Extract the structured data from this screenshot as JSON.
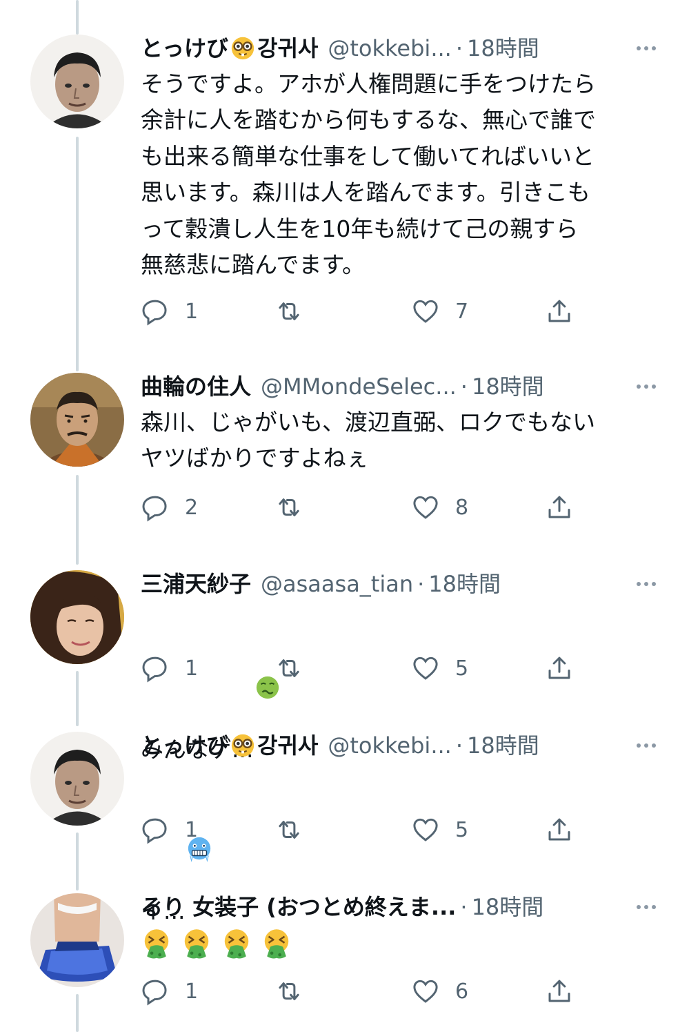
{
  "tweets": [
    {
      "name": "とっけび",
      "name_suffix": "강귀사",
      "name_emoji": "nerd-face-icon",
      "handle": "@tokkebi...",
      "time": "18時間",
      "text": "そうですよ。アホが人権問題に手をつけたら\n余計に人を踏むから何もするな、無心で誰で\nも出来る簡単な仕事をして働いてればいいと\n思います。森川は人を踏んでます。引きこも\nって穀潰し人生を10年も続けて己の親すら\n無慈悲に踏んでます。",
      "replies": "1",
      "retweets": "",
      "likes": "7"
    },
    {
      "name": "曲輪の住人",
      "handle": "@MMondeSelec...",
      "time": "18時間",
      "text": "森川、じゃがいも、渡辺直弼、ロクでもない\nヤツばかりですよねぇ",
      "replies": "2",
      "retweets": "",
      "likes": "8"
    },
    {
      "name": "三浦天紗子",
      "handle": "@asaasa_tian",
      "time": "18時間",
      "text": "みんなゲ...",
      "text_emoji": "nauseated-face-icon",
      "replies": "1",
      "retweets": "",
      "likes": "5"
    },
    {
      "name": "とっけび",
      "name_suffix": "강귀사",
      "name_emoji": "nerd-face-icon",
      "handle": "@tokkebi...",
      "time": "18時間",
      "text": "イ...",
      "text_emoji": "cold-face-icon",
      "replies": "1",
      "retweets": "",
      "likes": "5"
    },
    {
      "name": "るり 女装子 (おつとめ終えま...",
      "handle": "",
      "time": "18時間",
      "text": "",
      "emoji_row": [
        "vomiting-face-icon",
        "vomiting-face-icon",
        "vomiting-face-icon",
        "vomiting-face-icon"
      ],
      "replies": "1",
      "retweets": "",
      "likes": "6"
    }
  ],
  "separator": "·",
  "icons": {
    "reply": "reply-icon",
    "retweet": "retweet-icon",
    "like": "heart-icon",
    "share": "share-icon",
    "more": "more-icon"
  },
  "colors": {
    "text": "#0f1419",
    "secondary": "#536471",
    "icon": "#536471",
    "thread_line": "#cfd9de"
  }
}
